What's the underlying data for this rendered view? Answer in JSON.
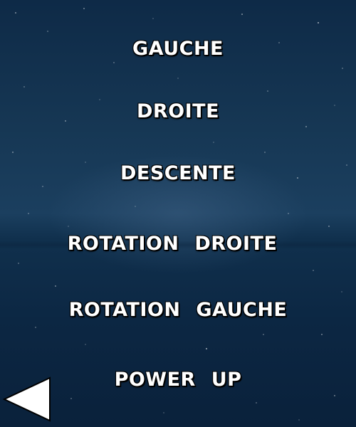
{
  "menu": {
    "items": [
      {
        "label": "GAUCHE"
      },
      {
        "label": "DROITE"
      },
      {
        "label": "DESCENTE"
      },
      {
        "label": "ROTATION DROITE"
      },
      {
        "label": "ROTATION GAUCHE"
      },
      {
        "label": "POWER UP"
      }
    ]
  },
  "back_button": {
    "icon": "back-arrow-icon"
  },
  "colors": {
    "text": "#ffffff",
    "background": "#163754",
    "arrow_fill": "#ffffff"
  }
}
